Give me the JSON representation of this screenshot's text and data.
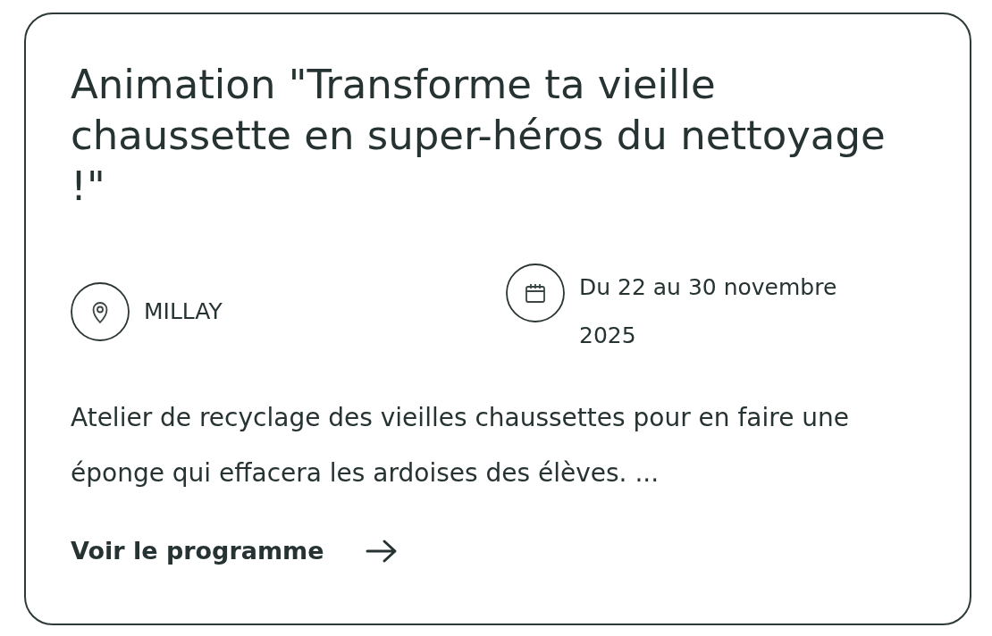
{
  "card": {
    "title": "Animation \"Transforme ta vieille chaussette en super-héros du nettoyage !\"",
    "meta": [
      {
        "kind": "location",
        "text": "MILLAY"
      },
      {
        "kind": "date",
        "text": "Du 22 au 30 novembre 2025"
      }
    ],
    "description": "Atelier de recyclage des vieilles chaussettes pour en faire une éponge qui effacera les ardoises des élèves. ...",
    "link": "Voir le programme"
  }
}
